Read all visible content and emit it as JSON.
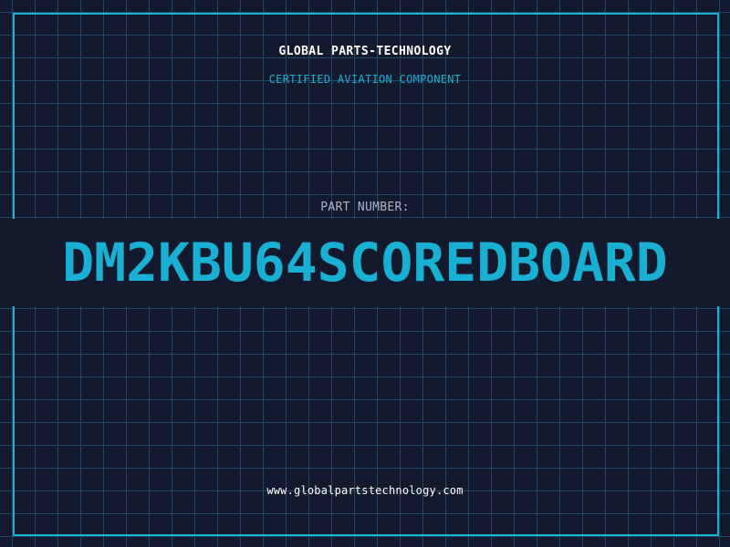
{
  "header": {
    "company": "GLOBAL PARTS-TECHNOLOGY",
    "subtitle": "CERTIFIED AVIATION COMPONENT"
  },
  "part": {
    "label": "PART NUMBER:",
    "number": "DM2KBU64SCOREDBOARD"
  },
  "footer": {
    "url": "www.globalpartstechnology.com"
  },
  "colors": {
    "background": "#131a2e",
    "grid": "#1f4a66",
    "accent": "#1ab0d4",
    "text": "#ffffff",
    "muted": "#aab6c8"
  }
}
